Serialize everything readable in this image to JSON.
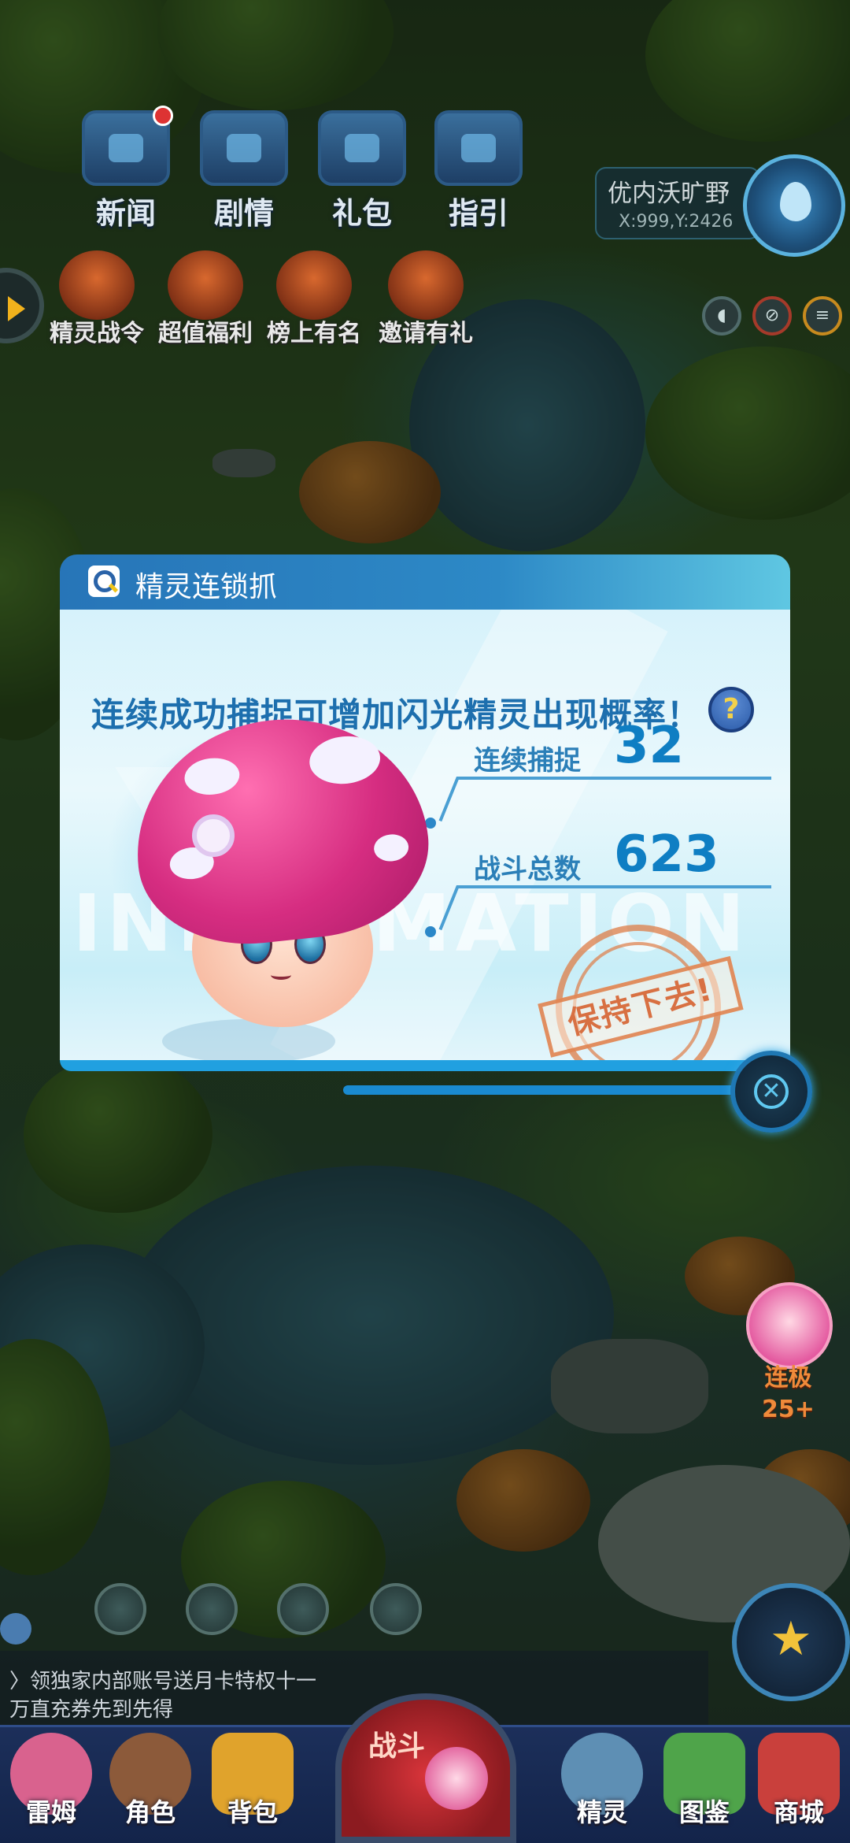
{
  "top_menu": [
    {
      "label": "新闻",
      "icon": "news-board-icon"
    },
    {
      "label": "剧情",
      "icon": "story-chest-icon"
    },
    {
      "label": "礼包",
      "icon": "gift-chest-icon"
    },
    {
      "label": "指引",
      "icon": "guide-chest-icon"
    }
  ],
  "activities": [
    {
      "label": "精灵战令",
      "icon": "battle-pass-icon"
    },
    {
      "label": "超值福利",
      "icon": "welfare-gift-icon"
    },
    {
      "label": "榜上有名",
      "icon": "trophy-icon"
    },
    {
      "label": "邀请有礼",
      "icon": "invite-envelope-icon"
    }
  ],
  "location": {
    "name": "优内沃旷野",
    "coord": "X:999,Y:2426"
  },
  "dialog": {
    "title": "精灵连锁抓",
    "headline": "连续成功捕捉可增加闪光精灵出现概率！",
    "help_symbol": "?",
    "watermark": "INFORMATION",
    "stats": [
      {
        "label": "连续捕捉",
        "value": "32"
      },
      {
        "label": "战斗总数",
        "value": "623"
      }
    ],
    "stamp": "保持下去!",
    "close_symbol": "✕"
  },
  "side_float": {
    "label": "连极",
    "value": "25+"
  },
  "chat": {
    "line1": "〉领独家内部账号送月卡特权十一",
    "line2": "万直充券先到先得"
  },
  "bottom_nav": [
    {
      "label": "雷姆",
      "icon": "pet-avatar-icon",
      "color": "#d9628e"
    },
    {
      "label": "角色",
      "icon": "character-icon",
      "color": "#8c5a3a"
    },
    {
      "label": "背包",
      "icon": "backpack-icon",
      "color": "#e0a32c"
    },
    {
      "label": "精灵",
      "icon": "sprite-icon",
      "color": "#5e8fb4"
    },
    {
      "label": "图鉴",
      "icon": "encyclopedia-icon",
      "color": "#4fa44a"
    },
    {
      "label": "商城",
      "icon": "shop-icon",
      "color": "#c9403c"
    }
  ],
  "battle_button": {
    "label": "战斗"
  }
}
